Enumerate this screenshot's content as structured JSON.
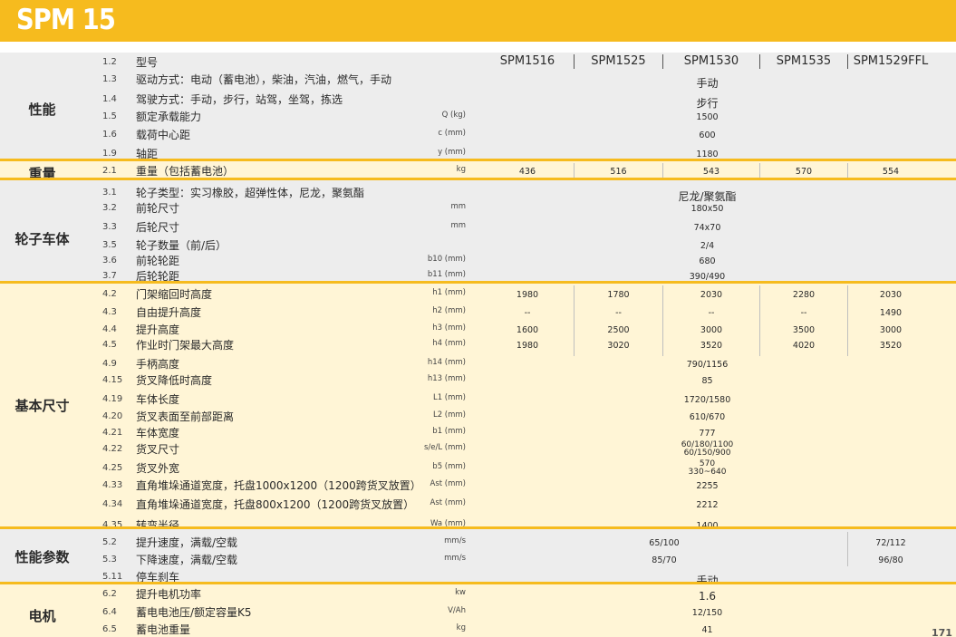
{
  "title": "SPM 15",
  "models": [
    "SPM1516",
    "SPM1525",
    "SPM1530",
    "SPM1535",
    "SPM1529FFL"
  ],
  "sections": [
    {
      "key": "performance",
      "label": "性能",
      "style": "gray",
      "rows": [
        {
          "num": "1.2",
          "name": "型号",
          "unit": "",
          "values": [
            "SPM1516",
            "SPM1525",
            "SPM1530",
            "SPM1535",
            "SPM1529FFL"
          ],
          "header": true
        },
        {
          "num": "1.3",
          "name": "驱动方式：电动（蓄电池），柴油，汽油，燃气，手动",
          "unit": "",
          "span": "手动"
        },
        {
          "num": "1.4",
          "name": "驾驶方式：手动，步行，站驾，坐驾，拣选",
          "unit": "",
          "span": "步行"
        },
        {
          "num": "1.5",
          "name": "额定承载能力",
          "unit": "Q (kg)",
          "span": "1500"
        },
        {
          "num": "1.6",
          "name": "载荷中心距",
          "unit": "c (mm)",
          "span": "600"
        },
        {
          "num": "1.9",
          "name": "轴距",
          "unit": "y (mm)",
          "span": "1180"
        }
      ]
    },
    {
      "key": "weight",
      "label": "重量",
      "style": "yellow",
      "rows": [
        {
          "num": "2.1",
          "name": "重量（包括蓄电池）",
          "unit": "kg",
          "values": [
            "436",
            "516",
            "543",
            "570",
            "554"
          ]
        }
      ]
    },
    {
      "key": "wheels",
      "label": "轮子车体",
      "style": "gray",
      "rows": [
        {
          "num": "3.1",
          "name": "轮子类型：实习橡胶，超弹性体，尼龙，聚氨酯",
          "unit": "",
          "span": "尼龙/聚氨酯"
        },
        {
          "num": "3.2",
          "name": "前轮尺寸",
          "unit": "mm",
          "span": "180x50"
        },
        {
          "num": "3.3",
          "name": "后轮尺寸",
          "unit": "mm",
          "span": "74x70"
        },
        {
          "num": "3.5",
          "name": "轮子数量（前/后）",
          "unit": "",
          "span": "2/4"
        },
        {
          "num": "3.6",
          "name": "前轮轮距",
          "unit": "b10 (mm)",
          "span": "680"
        },
        {
          "num": "3.7",
          "name": "后轮轮距",
          "unit": "b11 (mm)",
          "span": "390/490"
        }
      ]
    },
    {
      "key": "dimensions",
      "label": "基本尺寸",
      "style": "yellow",
      "rows": [
        {
          "num": "4.2",
          "name": "门架缩回时高度",
          "unit": "h1 (mm)",
          "values": [
            "1980",
            "1780",
            "2030",
            "2280",
            "2030"
          ]
        },
        {
          "num": "4.3",
          "name": "自由提升高度",
          "unit": "h2 (mm)",
          "values": [
            "--",
            "--",
            "--",
            "--",
            "1490"
          ]
        },
        {
          "num": "4.4",
          "name": "提升高度",
          "unit": "h3 (mm)",
          "values": [
            "1600",
            "2500",
            "3000",
            "3500",
            "3000"
          ]
        },
        {
          "num": "4.5",
          "name": "作业时门架最大高度",
          "unit": "h4 (mm)",
          "values": [
            "1980",
            "3020",
            "3520",
            "4020",
            "3520"
          ]
        },
        {
          "num": "4.9",
          "name": "手柄高度",
          "unit": "h14 (mm)",
          "span": "790/1156"
        },
        {
          "num": "4.15",
          "name": "货叉降低时高度",
          "unit": "h13 (mm)",
          "span": "85"
        },
        {
          "num": "4.19",
          "name": "车体长度",
          "unit": "L1 (mm)",
          "span": "1720/1580"
        },
        {
          "num": "4.20",
          "name": "货叉表面至前部距离",
          "unit": "L2 (mm)",
          "span": "610/670"
        },
        {
          "num": "4.21",
          "name": "车体宽度",
          "unit": "b1 (mm)",
          "span": "777"
        },
        {
          "num": "4.22",
          "name": "货叉尺寸",
          "unit": "s/e/L (mm)",
          "span": "60/180/1100",
          "span2": "60/150/900"
        },
        {
          "num": "4.25",
          "name": "货叉外宽",
          "unit": "b5 (mm)",
          "span": "570",
          "span2": "330~640"
        },
        {
          "num": "4.33",
          "name": "直角堆垛通道宽度，托盘1000x1200（1200跨货叉放置）",
          "unit": "Ast (mm)",
          "span": "2255"
        },
        {
          "num": "4.34",
          "name": "直角堆垛通道宽度，托盘800x1200（1200跨货叉放置）",
          "unit": "Ast (mm)",
          "span": "2212"
        },
        {
          "num": "4.35",
          "name": "转弯半径",
          "unit": "Wa (mm)",
          "span": "1400"
        }
      ]
    },
    {
      "key": "params",
      "label": "性能参数",
      "style": "gray",
      "rows": [
        {
          "num": "5.2",
          "name": "提升速度，满载/空载",
          "unit": "mm/s",
          "span": "65/100",
          "last": "72/112"
        },
        {
          "num": "5.3",
          "name": "下降速度，满载/空载",
          "unit": "mm/s",
          "span": "85/70",
          "last": "96/80"
        },
        {
          "num": "5.11",
          "name": "停车刹车",
          "unit": "",
          "span": "手动"
        }
      ]
    },
    {
      "key": "motor",
      "label": "电机",
      "style": "yellow",
      "rows": [
        {
          "num": "6.2",
          "name": "提升电机功率",
          "unit": "kw",
          "span": "1.6"
        },
        {
          "num": "6.4",
          "name": "蓄电电池压/额定容量K5",
          "unit": "V/Ah",
          "span": "12/150"
        },
        {
          "num": "6.5",
          "name": "蓄电池重量",
          "unit": "kg",
          "span": "41"
        }
      ]
    }
  ],
  "page_number": "171"
}
